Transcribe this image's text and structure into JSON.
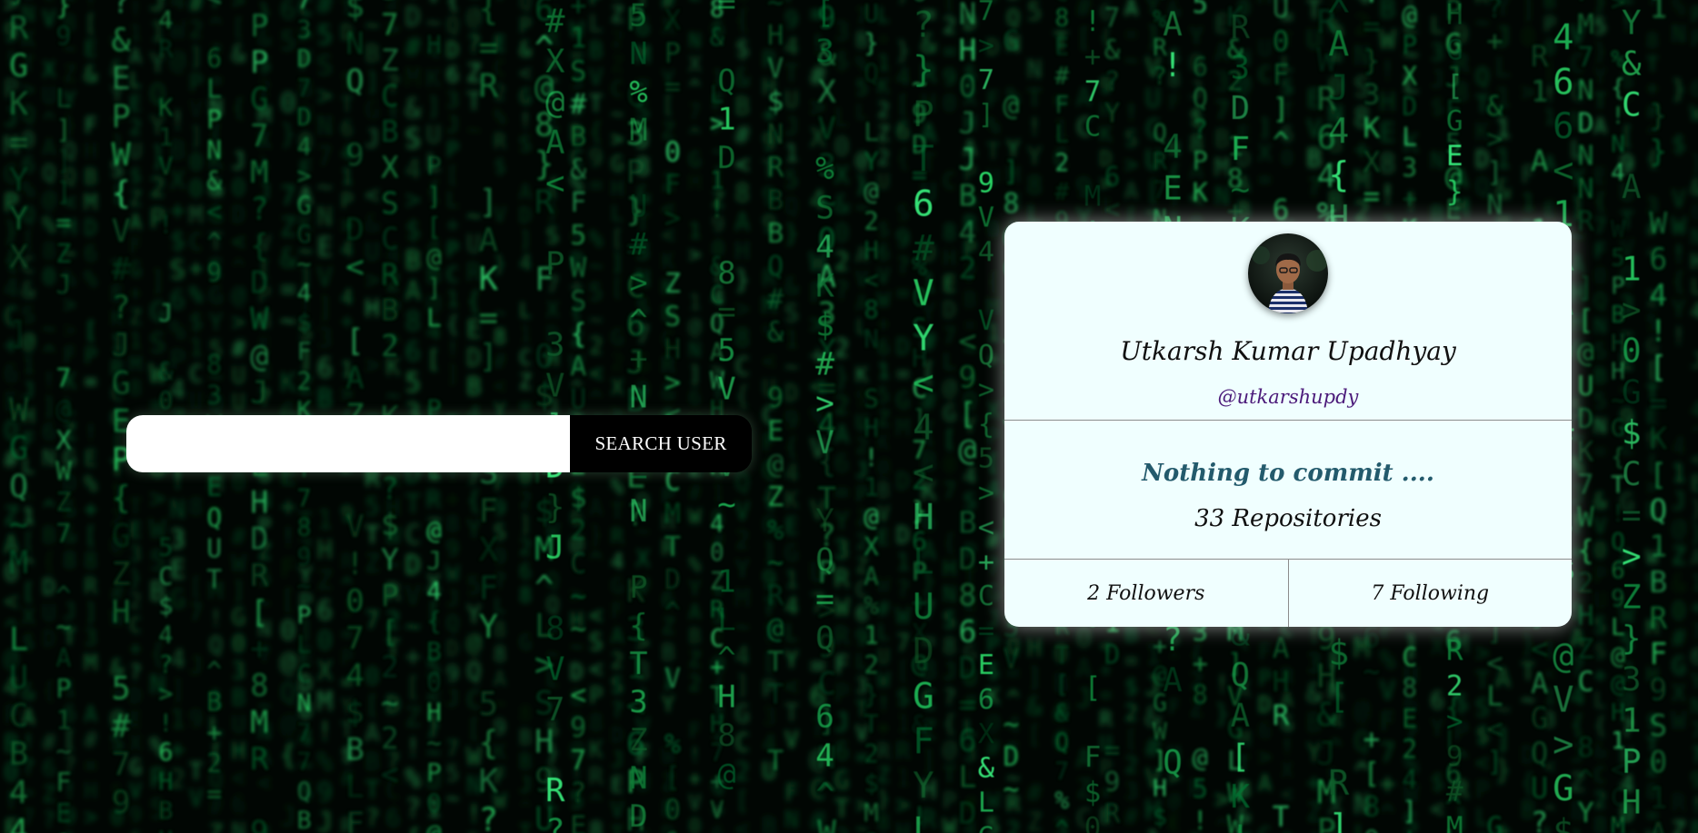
{
  "search": {
    "input_value": "",
    "button_label": "SEARCH USER"
  },
  "profile": {
    "name": "Utkarsh Kumar Upadhyay",
    "username": "@utkarshupdy",
    "bio": "Nothing to commit ....",
    "repositories": "33 Repositories",
    "followers": "2 Followers",
    "following": "7 Following",
    "avatar_icon": "user-avatar-photo"
  },
  "colors": {
    "card_background": "#f0ffff",
    "handle": "#4b1a7a",
    "bio": "#235a6c",
    "button_background": "#000000",
    "background_code_green": "#1fbf5a"
  }
}
